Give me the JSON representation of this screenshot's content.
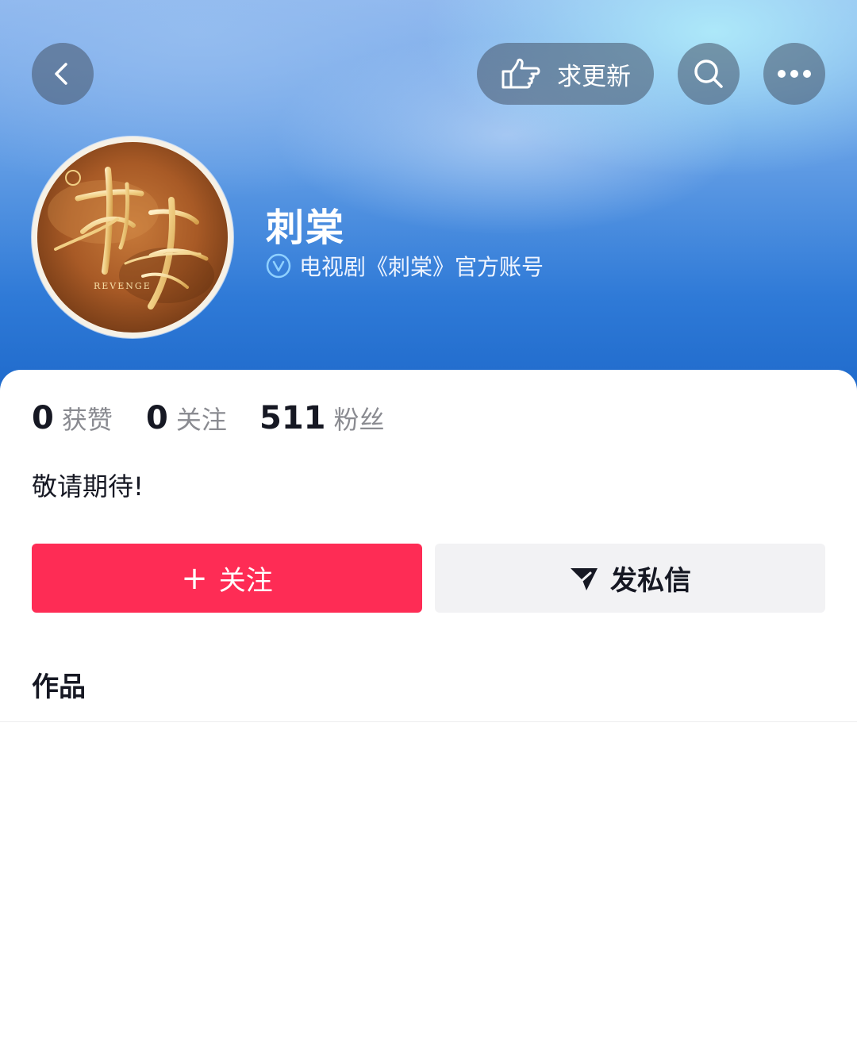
{
  "header": {
    "back_icon": "chevron-left-icon",
    "request_update": {
      "icon": "pointing-hand-icon",
      "label": "求更新"
    },
    "search_icon": "search-icon",
    "more_icon": "more-dots-icon"
  },
  "profile": {
    "name": "刺棠",
    "verified_icon": "verified-v-icon",
    "verification": "电视剧《刺棠》官方账号",
    "avatar_logo_text": "刺棠",
    "avatar_logo_subtitle": "REVENGE"
  },
  "stats": [
    {
      "value": "0",
      "label": "获赞"
    },
    {
      "value": "0",
      "label": "关注"
    },
    {
      "value": "511",
      "label": "粉丝"
    }
  ],
  "bio": "敬请期待!",
  "actions": {
    "follow": {
      "plus": "+",
      "label": "关注"
    },
    "message": {
      "icon": "paper-plane-icon",
      "label": "发私信"
    }
  },
  "tabs": {
    "works": "作品"
  },
  "colors": {
    "accent_follow": "#fe2c55",
    "message_bg": "#f2f2f4",
    "header_blue": "#2f7ad7"
  }
}
